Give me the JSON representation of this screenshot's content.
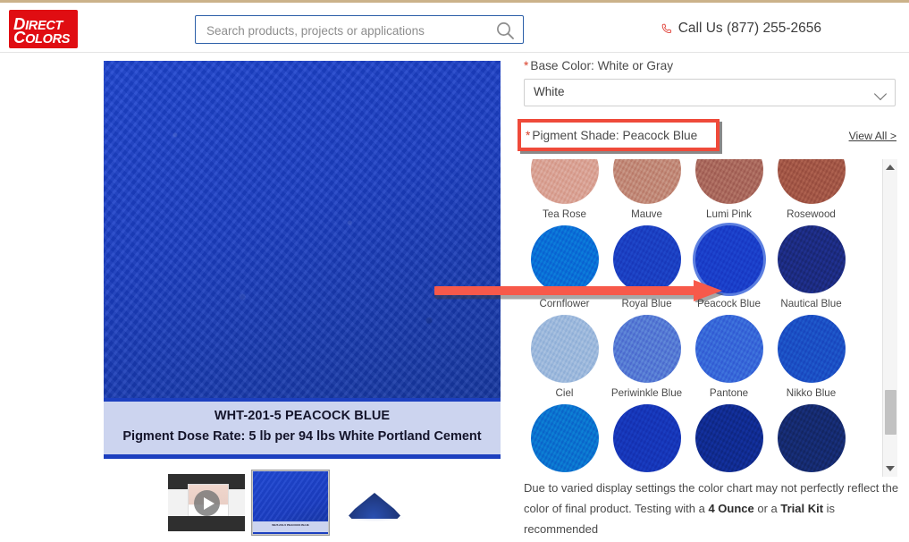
{
  "header": {
    "logo_line1": "DIRECT",
    "logo_line2": "COLORS",
    "logo_color": "#e00d12",
    "search_placeholder": "Search products, projects or applications",
    "search_value": "",
    "search_icon": "search-icon",
    "phone_icon": "phone-icon",
    "call_us": "Call Us (877) 255-2656"
  },
  "product": {
    "image_color": "#1b3ec4",
    "caption_line1": "WHT-201-5 PEACOCK BLUE",
    "caption_line2": "Pigment Dose Rate: 5 lb per 94 lbs White Portland Cement",
    "caption_band_color": "#ccd4ef",
    "thumbnails": [
      {
        "name": "video-thumbnail",
        "type": "video",
        "selected": false
      },
      {
        "name": "swatch-thumbnail",
        "type": "image",
        "selected": true
      },
      {
        "name": "pigment-powder-thumbnail",
        "type": "image",
        "selected": false
      }
    ]
  },
  "options": {
    "base_color_label": "Base Color: White or Gray",
    "base_color_value": "White",
    "pigment_shade_label": "Pigment Shade: Peacock Blue",
    "view_all_label": "View All >",
    "required_marker": "*"
  },
  "swatches": {
    "selected": "Peacock Blue",
    "rows": [
      [
        {
          "name": "Tea Rose",
          "color": "#d9a294"
        },
        {
          "name": "Mauve",
          "color": "#c18877"
        },
        {
          "name": "Lumi Pink",
          "color": "#a9685c"
        },
        {
          "name": "Rosewood",
          "color": "#a25646"
        }
      ],
      [
        {
          "name": "Cornflower",
          "color": "#0a6fd6"
        },
        {
          "name": "Royal Blue",
          "color": "#1b3fc2"
        },
        {
          "name": "Peacock Blue",
          "color": "#1a3ec9"
        },
        {
          "name": "Nautical Blue",
          "color": "#1c2b80"
        }
      ],
      [
        {
          "name": "Ciel",
          "color": "#9cb8dc"
        },
        {
          "name": "Periwinkle Blue",
          "color": "#5579d4"
        },
        {
          "name": "Pantone",
          "color": "#3767d8"
        },
        {
          "name": "Nikko Blue",
          "color": "#1b4fc4"
        }
      ],
      [
        {
          "name": "",
          "color": "#0b72cf"
        },
        {
          "name": "",
          "color": "#1636b8"
        },
        {
          "name": "",
          "color": "#102b90"
        },
        {
          "name": "",
          "color": "#152a6e"
        }
      ]
    ]
  },
  "disclaimer": {
    "part1": "Due to varied display settings the color chart may not perfectly reflect the color of final product. Testing with a ",
    "bold1": "4 Ounce",
    "part2": " or a ",
    "bold2": "Trial Kit",
    "part3": " is recommended"
  },
  "annotation": {
    "arrow_color": "#f7594a",
    "box_color": "#ef4a3a",
    "target": "Peacock Blue"
  }
}
